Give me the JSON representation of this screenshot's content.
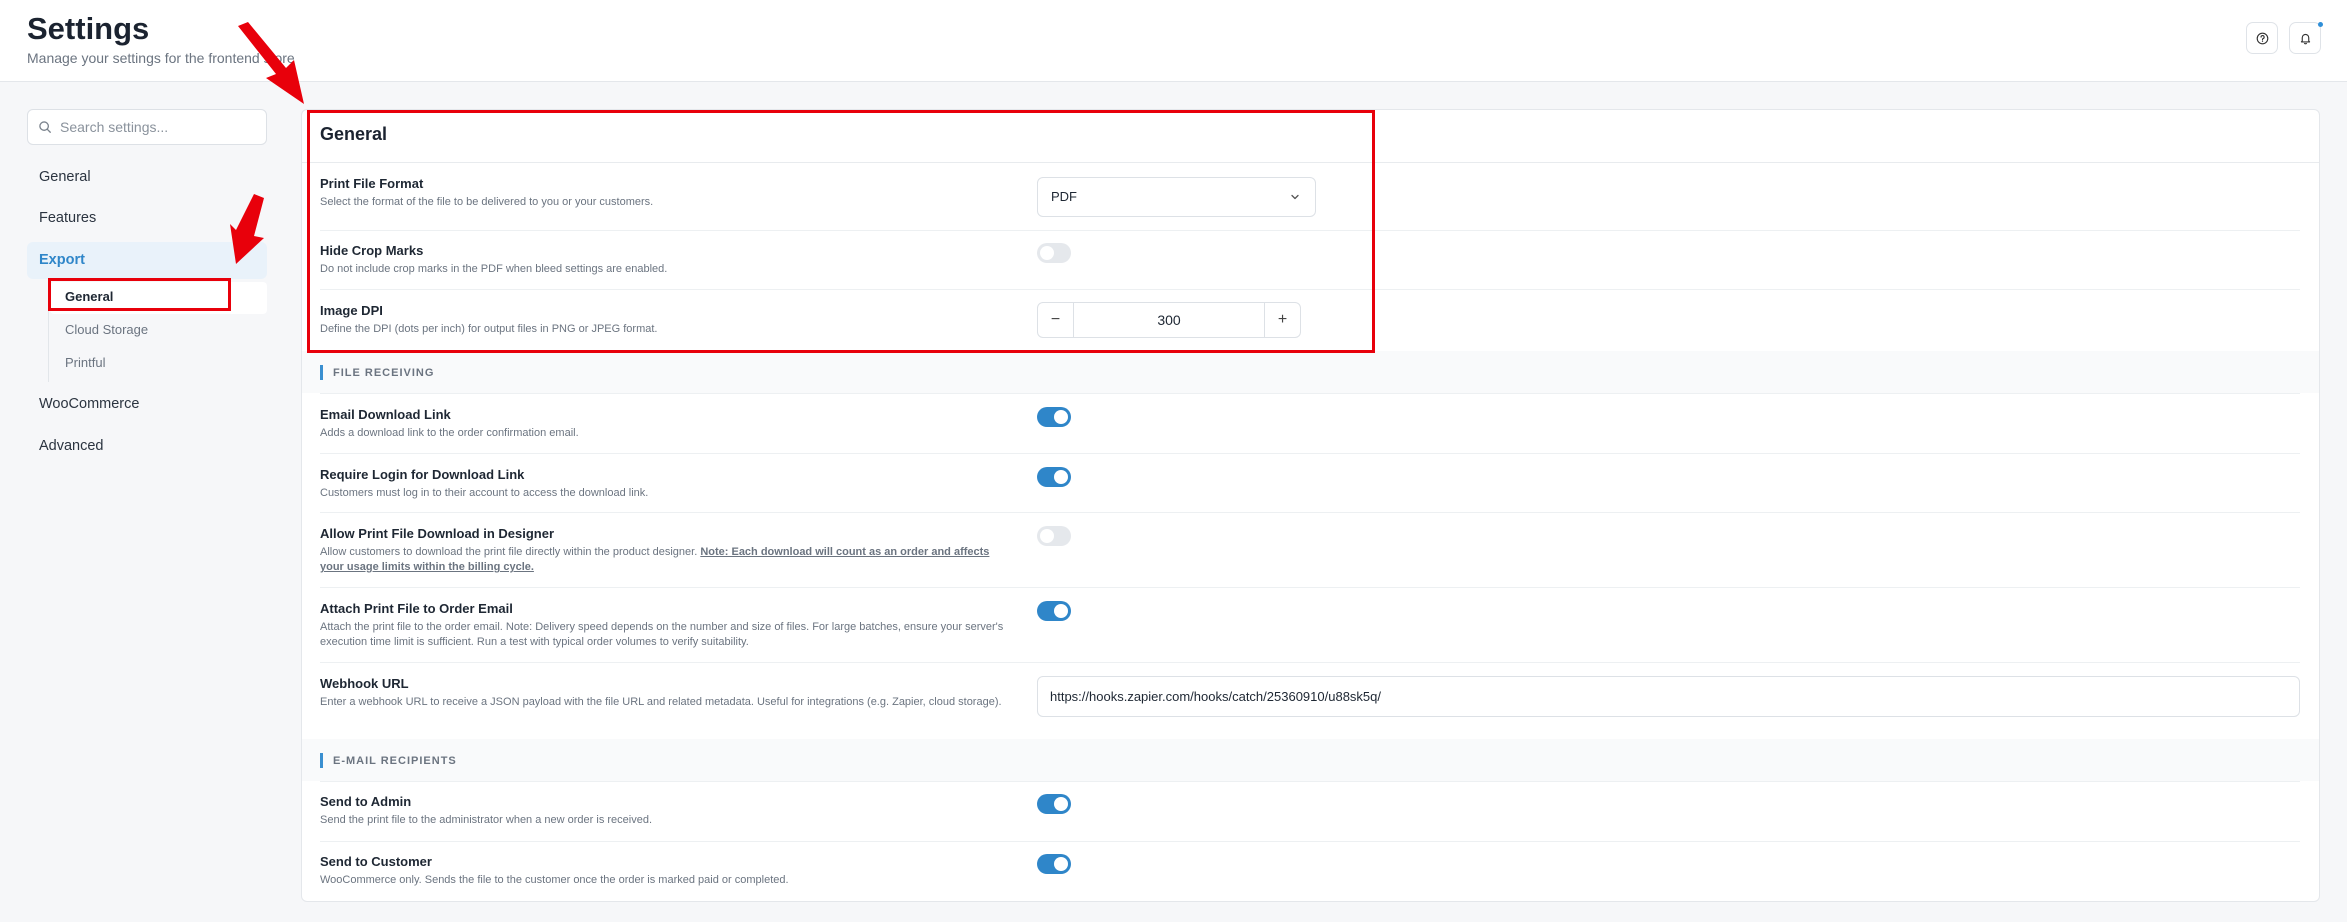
{
  "header": {
    "title": "Settings",
    "subtitle": "Manage your settings for the frontend store"
  },
  "sidebar": {
    "search_placeholder": "Search settings...",
    "items": [
      {
        "label": "General"
      },
      {
        "label": "Features"
      },
      {
        "label": "Export",
        "active": true
      },
      {
        "label": "WooCommerce"
      },
      {
        "label": "Advanced"
      }
    ],
    "export_sub": [
      {
        "label": "General",
        "current": true
      },
      {
        "label": "Cloud Storage"
      },
      {
        "label": "Printful"
      }
    ]
  },
  "panel": {
    "title": "General",
    "print_format": {
      "label": "Print File Format",
      "desc": "Select the format of the file to be delivered to you or your customers.",
      "value": "PDF"
    },
    "hide_crop": {
      "label": "Hide Crop Marks",
      "desc": "Do not include crop marks in the PDF when bleed settings are enabled.",
      "on": false
    },
    "image_dpi": {
      "label": "Image DPI",
      "desc": "Define the DPI (dots per inch) for output files in PNG or JPEG format.",
      "value": "300",
      "minus": "−",
      "plus": "+"
    },
    "section_file_receiving": "FILE RECEIVING",
    "email_link": {
      "label": "Email Download Link",
      "desc": "Adds a download link to the order confirmation email.",
      "on": true
    },
    "require_login": {
      "label": "Require Login for Download Link",
      "desc": "Customers must log in to their account to access the download link.",
      "on": true
    },
    "allow_download": {
      "label": "Allow Print File Download in Designer",
      "desc_prefix": "Allow customers to download the print file directly within the product designer.",
      "desc_note": "Note: Each download will count as an order and affects your usage limits within the billing cycle.",
      "on": false
    },
    "attach_email": {
      "label": "Attach Print File to Order Email",
      "desc": "Attach the print file to the order email. Note: Delivery speed depends on the number and size of files. For large batches, ensure your server's execution time limit is sufficient. Run a test with typical order volumes to verify suitability.",
      "on": true
    },
    "webhook": {
      "label": "Webhook URL",
      "desc": "Enter a webhook URL to receive a JSON payload with the file URL and related metadata. Useful for integrations (e.g. Zapier, cloud storage).",
      "value": "https://hooks.zapier.com/hooks/catch/25360910/u88sk5q/"
    },
    "section_email_recipients": "E-MAIL RECIPIENTS",
    "send_admin": {
      "label": "Send to Admin",
      "desc": "Send the print file to the administrator when a new order is received.",
      "on": true
    },
    "send_customer": {
      "label": "Send to Customer",
      "desc": "WooCommerce only. Sends the file to the customer once the order is marked paid or completed.",
      "on": true
    }
  },
  "icons": {
    "help": "question-circle-icon",
    "bell": "bell-icon",
    "search": "search-icon",
    "chevron": "chevron-down-icon"
  },
  "colors": {
    "accent": "#2f86c9",
    "annotation": "#e8000b"
  }
}
